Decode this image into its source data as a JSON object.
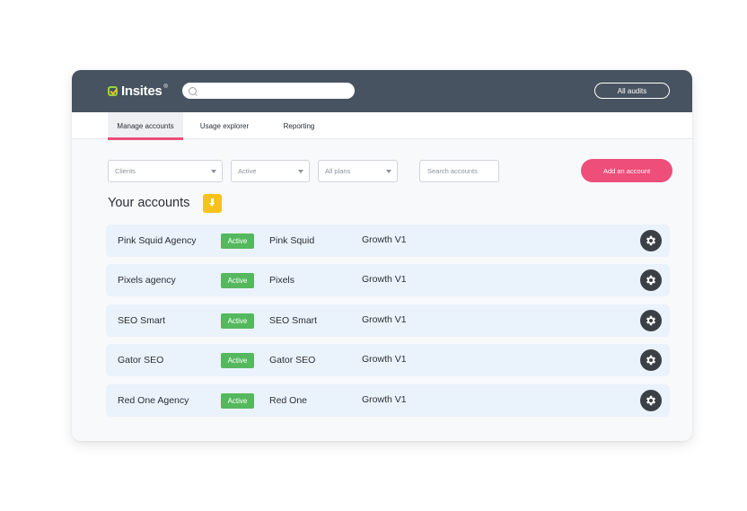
{
  "header": {
    "logo_text": "Insites",
    "logo_mark": "®",
    "search_placeholder": "",
    "all_audits_label": "All audits"
  },
  "tabs": [
    {
      "label": "Manage accounts",
      "active": true
    },
    {
      "label": "Usage explorer",
      "active": false
    },
    {
      "label": "Reporting",
      "active": false
    }
  ],
  "filters": {
    "clients": "Clients",
    "status": "Active",
    "plans": "All plans",
    "search_placeholder": "Search accounts",
    "add_label": "Add an account"
  },
  "section_title": "Your accounts",
  "accounts": [
    {
      "name": "Pink Squid Agency",
      "status": "Active",
      "client": "Pink Squid",
      "plan": "Growth V1"
    },
    {
      "name": "Pixels agency",
      "status": "Active",
      "client": "Pixels",
      "plan": "Growth V1"
    },
    {
      "name": "SEO Smart",
      "status": "Active",
      "client": "SEO Smart",
      "plan": "Growth V1"
    },
    {
      "name": "Gator SEO",
      "status": "Active",
      "client": "Gator SEO",
      "plan": "Growth V1"
    },
    {
      "name": "Red One Agency",
      "status": "Active",
      "client": "Red One",
      "plan": "Growth V1"
    }
  ],
  "colors": {
    "topbar": "#475360",
    "accent": "#ee4e7a",
    "active_badge": "#55b85f",
    "download_button": "#f7c21b",
    "row_bg": "#eaf2fb"
  }
}
